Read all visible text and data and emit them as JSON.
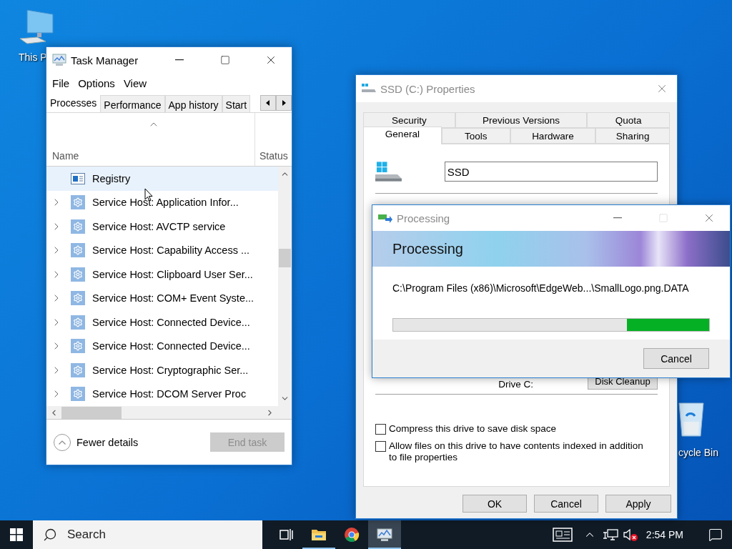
{
  "desktop_icons": [
    {
      "kind": "computer",
      "label": "This P"
    },
    {
      "kind": "recycle",
      "label": "cycle Bin"
    }
  ],
  "task_manager": {
    "title": "Task Manager",
    "menu": [
      "File",
      "Options",
      "View"
    ],
    "tabs": [
      {
        "label": "Processes",
        "selected": true
      },
      {
        "label": "Performance",
        "selected": false
      },
      {
        "label": "App history",
        "selected": false
      },
      {
        "label": "Start",
        "selected": false
      }
    ],
    "columns": [
      "Name",
      "Status"
    ],
    "rows": [
      {
        "kind": "app",
        "name": "Registry",
        "selected": true
      },
      {
        "kind": "service",
        "name": "Service Host: Application Infor...",
        "selected": false
      },
      {
        "kind": "service",
        "name": "Service Host: AVCTP service",
        "selected": false
      },
      {
        "kind": "service",
        "name": "Service Host: Capability Access ...",
        "selected": false
      },
      {
        "kind": "service",
        "name": "Service Host: Clipboard User Ser...",
        "selected": false
      },
      {
        "kind": "service",
        "name": "Service Host: COM+ Event Syste...",
        "selected": false
      },
      {
        "kind": "service",
        "name": "Service Host: Connected Device...",
        "selected": false
      },
      {
        "kind": "service",
        "name": "Service Host: Connected Device...",
        "selected": false
      },
      {
        "kind": "service",
        "name": "Service Host: Cryptographic Ser...",
        "selected": false
      },
      {
        "kind": "service",
        "name": "Service Host: DCOM Server Proc",
        "selected": false
      }
    ],
    "fewer_details": "Fewer details",
    "end_task": {
      "label": "End task",
      "disabled": true
    }
  },
  "properties": {
    "title": "SSD (C:) Properties",
    "tab_rows": [
      [
        {
          "label": "Security",
          "selected": false
        },
        {
          "label": "Previous Versions",
          "selected": false
        },
        {
          "label": "Quota",
          "selected": false
        }
      ],
      [
        {
          "label": "General",
          "selected": true
        },
        {
          "label": "Tools",
          "selected": false
        },
        {
          "label": "Hardware",
          "selected": false
        },
        {
          "label": "Sharing",
          "selected": false
        }
      ]
    ],
    "name_value": "SSD",
    "drive_label": "Drive C:",
    "cleanup_button": "Disk Cleanup",
    "checkboxes": [
      {
        "label": "Compress this drive to save disk space",
        "checked": false
      },
      {
        "label": "Allow files on this drive to have contents indexed in addition to file properties",
        "checked": false
      }
    ],
    "buttons": [
      "OK",
      "Cancel",
      "Apply"
    ]
  },
  "processing": {
    "title": "Processing",
    "heading": "Processing",
    "path": "C:\\Program Files (x86)\\Microsoft\\EdgeWeb...\\SmallLogo.png.DATA",
    "progress": {
      "level": 0.26
    },
    "cancel": "Cancel"
  },
  "taskbar": {
    "search_placeholder": "Search",
    "apps": [
      {
        "kind": "task-view",
        "running": false,
        "selected": false
      },
      {
        "kind": "explorer",
        "running": true,
        "selected": false
      },
      {
        "kind": "browser",
        "running": false,
        "selected": false
      },
      {
        "kind": "task-manager",
        "running": true,
        "selected": true
      }
    ],
    "time": "2:54 PM"
  }
}
